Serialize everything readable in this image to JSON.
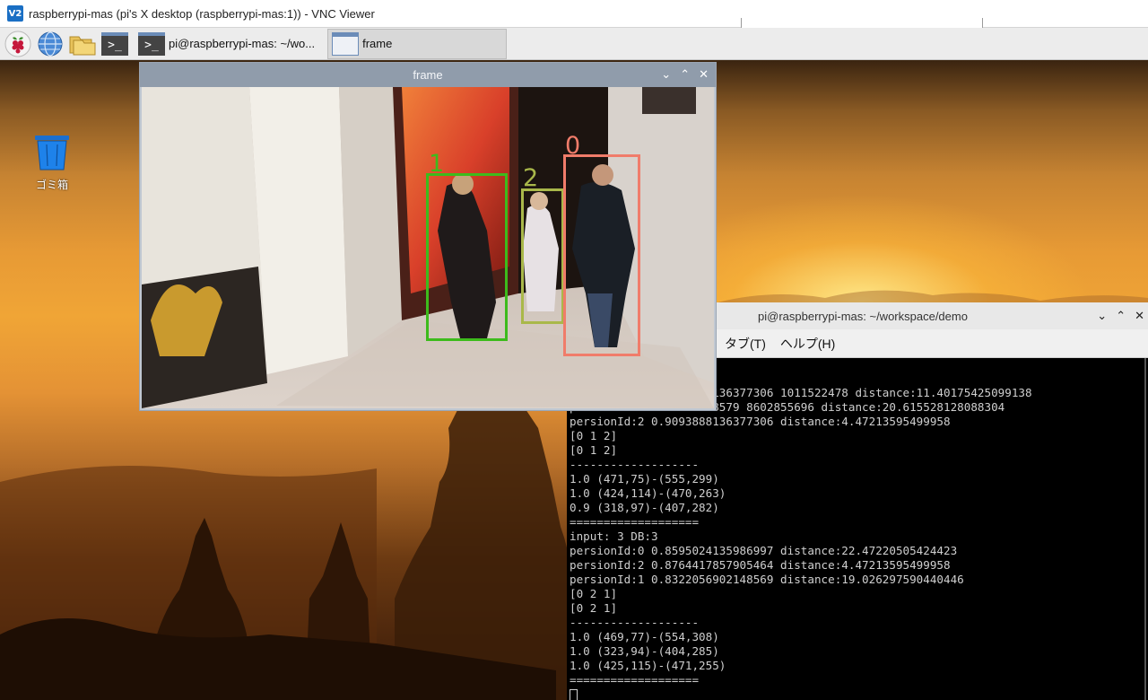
{
  "vnc": {
    "title": "raspberrypi-mas (pi's X desktop (raspberrypi-mas:1)) - VNC Viewer",
    "logo_text": "V2"
  },
  "taskbar": {
    "items": [
      {
        "icon": "raspberry-icon"
      },
      {
        "icon": "web-browser-icon"
      },
      {
        "icon": "file-manager-icon"
      },
      {
        "icon": "terminal-icon"
      }
    ],
    "tasks": [
      {
        "label": "pi@raspberrypi-mas: ~/wo...",
        "icon": "terminal-icon",
        "active": false
      },
      {
        "label": "frame",
        "icon": "frame-window-icon",
        "active": true
      }
    ]
  },
  "desktop": {
    "trash_label": "ゴミ箱"
  },
  "frame_window": {
    "title": "frame",
    "controls": {
      "minimize": "⌄",
      "maximize": "⌃",
      "close": "✕"
    },
    "detections": [
      {
        "id": "1",
        "color": "#3dbb1c"
      },
      {
        "id": "2",
        "color": "#a9b84a"
      },
      {
        "id": "0",
        "color": "#f07c6a"
      }
    ]
  },
  "terminal": {
    "title": "pi@raspberrypi-mas: ~/workspace/demo",
    "controls": {
      "minimize": "⌄",
      "maximize": "⌃",
      "close": "✕"
    },
    "menu": [
      "タブ(T)",
      "ヘルプ(H)"
    ],
    "lines": [
      "persionId:0 0.9093888136377306 1011522478 distance:11.40175425099138",
      "persionId:1 0.87644178579 8602855696 distance:20.615528128088304",
      "persionId:2 0.9093888136377306 distance:4.47213595499958",
      "[0 1 2]",
      "[0 1 2]",
      "-------------------",
      "1.0 (471,75)-(555,299)",
      "1.0 (424,114)-(470,263)",
      "0.9 (318,97)-(407,282)",
      "===================",
      "input: 3 DB:3",
      "persionId:0 0.8595024135986997 distance:22.47220505424423",
      "persionId:2 0.8764417857905464 distance:4.47213595499958",
      "persionId:1 0.8322056902148569 distance:19.026297590440446",
      "[0 2 1]",
      "[0 2 1]",
      "-------------------",
      "1.0 (469,77)-(554,308)",
      "1.0 (323,94)-(404,285)",
      "1.0 (425,115)-(471,255)",
      "==================="
    ]
  }
}
